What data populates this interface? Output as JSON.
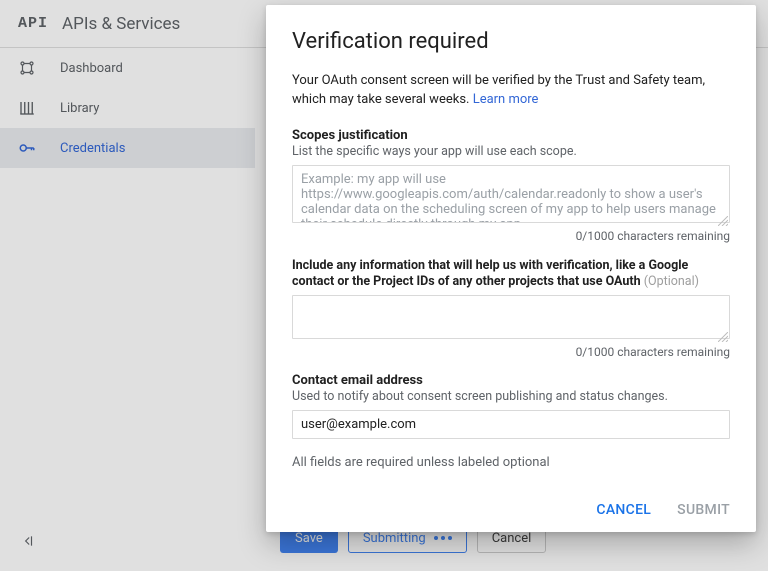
{
  "topbar": {
    "logo": "API",
    "title": "APIs & Services"
  },
  "sidebar": {
    "items": [
      {
        "label": "Dashboard"
      },
      {
        "label": "Library"
      },
      {
        "label": "Credentials"
      }
    ],
    "activeIndex": 2
  },
  "page": {
    "buttons": {
      "save": "Save",
      "submitting": "Submitting",
      "cancel": "Cancel"
    }
  },
  "modal": {
    "title": "Verification required",
    "desc_part1": "Your OAuth consent screen will be verified by the Trust and Safety team, which may take several weeks. ",
    "learn_more": "Learn more",
    "scopes": {
      "label": "Scopes justification",
      "sublabel": "List the specific ways your app will use each scope.",
      "placeholder": "Example: my app will use https://www.googleapis.com/auth/calendar.readonly to show a user's calendar data on the scheduling screen of my app to help users manage their schedule directly through my app.",
      "counter": "0/1000 characters remaining"
    },
    "extra": {
      "label_pre": "Include any information that will help us with verification, like a Google contact or the Project IDs of any other projects that use OAuth",
      "optional": " (Optional)",
      "counter": "0/1000 characters remaining"
    },
    "email": {
      "label": "Contact email address",
      "sublabel": "Used to notify about consent screen publishing and status changes.",
      "value": "user@example.com"
    },
    "footnote": "All fields are required unless labeled optional",
    "actions": {
      "cancel": "CANCEL",
      "submit": "SUBMIT"
    }
  }
}
